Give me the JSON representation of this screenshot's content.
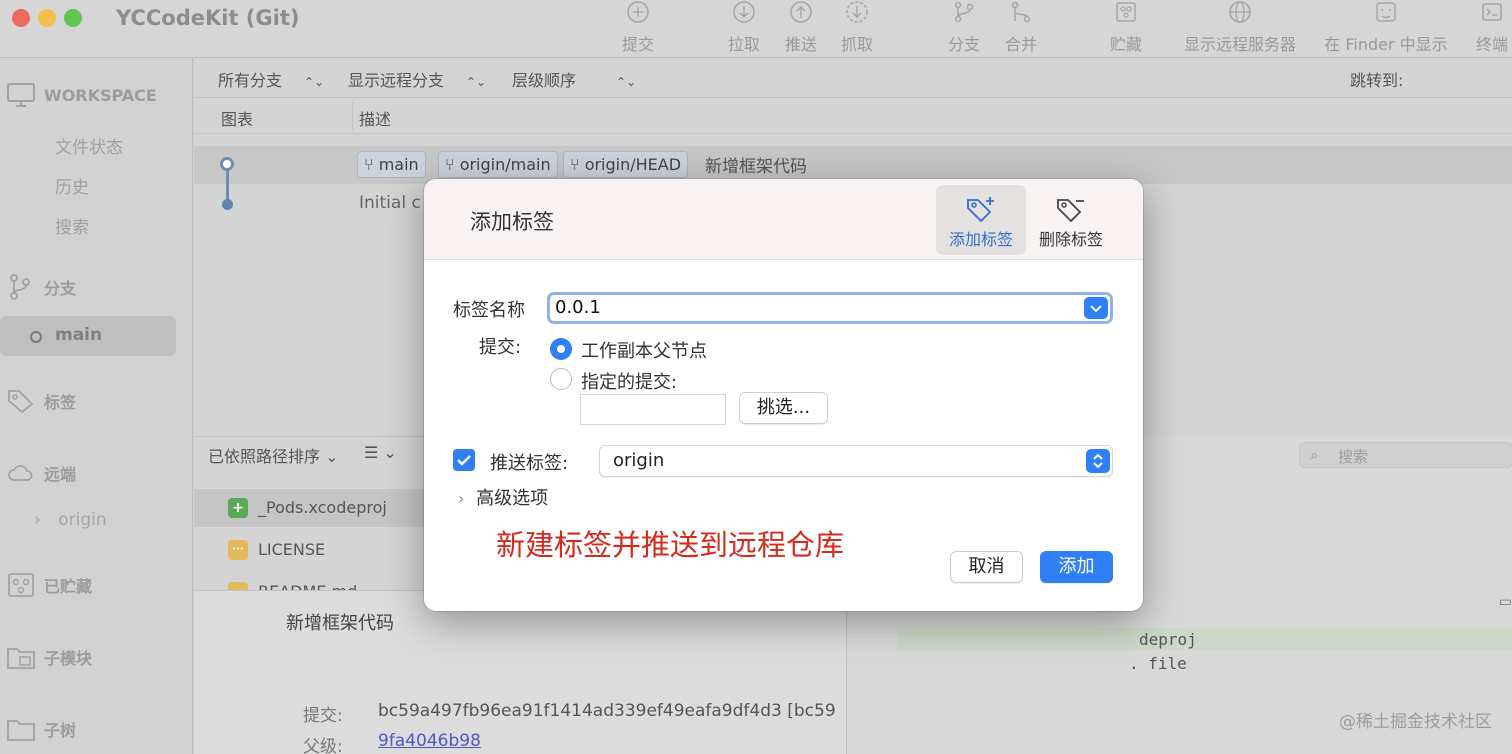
{
  "window": {
    "title": "YCCodeKit (Git)"
  },
  "toolbar": {
    "commit": "提交",
    "pull": "拉取",
    "push": "推送",
    "fetch": "抓取",
    "branch": "分支",
    "merge": "合并",
    "stash": "贮藏",
    "show_remote": "显示远程服务器",
    "finder": "在 Finder 中显示",
    "terminal": "终端"
  },
  "sidebar": {
    "workspace": "WORKSPACE",
    "file_status": "文件状态",
    "history": "历史",
    "search": "搜索",
    "branches": "分支",
    "current_branch": "main",
    "tags": "标签",
    "remotes": "远端",
    "remote_origin": "origin",
    "stashes": "已贮藏",
    "submodules": "子模块",
    "subtrees": "子树"
  },
  "filters": {
    "all_branches": "所有分支",
    "show_remote_branches": "显示远程分支",
    "hierarchy_order": "层级顺序",
    "jump_to": "跳转到:"
  },
  "columns": {
    "graph": "图表",
    "description": "描述"
  },
  "commits": [
    {
      "badges": [
        "main",
        "origin/main",
        "origin/HEAD"
      ],
      "message": "新增框架代码"
    },
    {
      "message": "Initial c"
    }
  ],
  "files_bar": {
    "sort": "已依照路径排序 ⌄",
    "view": "☰ ⌄"
  },
  "files": [
    {
      "name": "_Pods.xcodeproj",
      "status": "+"
    },
    {
      "name": "LICENSE",
      "status": "···"
    },
    {
      "name": "README.md",
      "status": "···"
    }
  ],
  "detail": {
    "title": "新增框架代码",
    "commit_label": "提交:",
    "commit_hash": "bc59a497fb96ea91f1414ad339ef49eafa9df4d3 [bc59",
    "parent_label": "父级:",
    "parent_hash": "9fa4046b98"
  },
  "diff": {
    "search_placeholder": "搜索",
    "line1": "deproj",
    "line2": ". file"
  },
  "watermark": "@稀土掘金技术社区",
  "dialog": {
    "title": "添加标签",
    "tab_add": "添加标签",
    "tab_delete": "删除标签",
    "tag_name_label": "标签名称",
    "tag_name_value": "0.0.1",
    "commit_label": "提交:",
    "radio_working_parent": "工作副本父节点",
    "radio_specified": "指定的提交:",
    "specified_commit_value": "",
    "pick_button": "挑选...",
    "push_tag_label": "推送标签:",
    "push_remote": "origin",
    "advanced": "高级选项",
    "annotation": "新建标签并推送到远程仓库",
    "cancel": "取消",
    "add": "添加",
    "accent_color": "#2f7ff5"
  }
}
